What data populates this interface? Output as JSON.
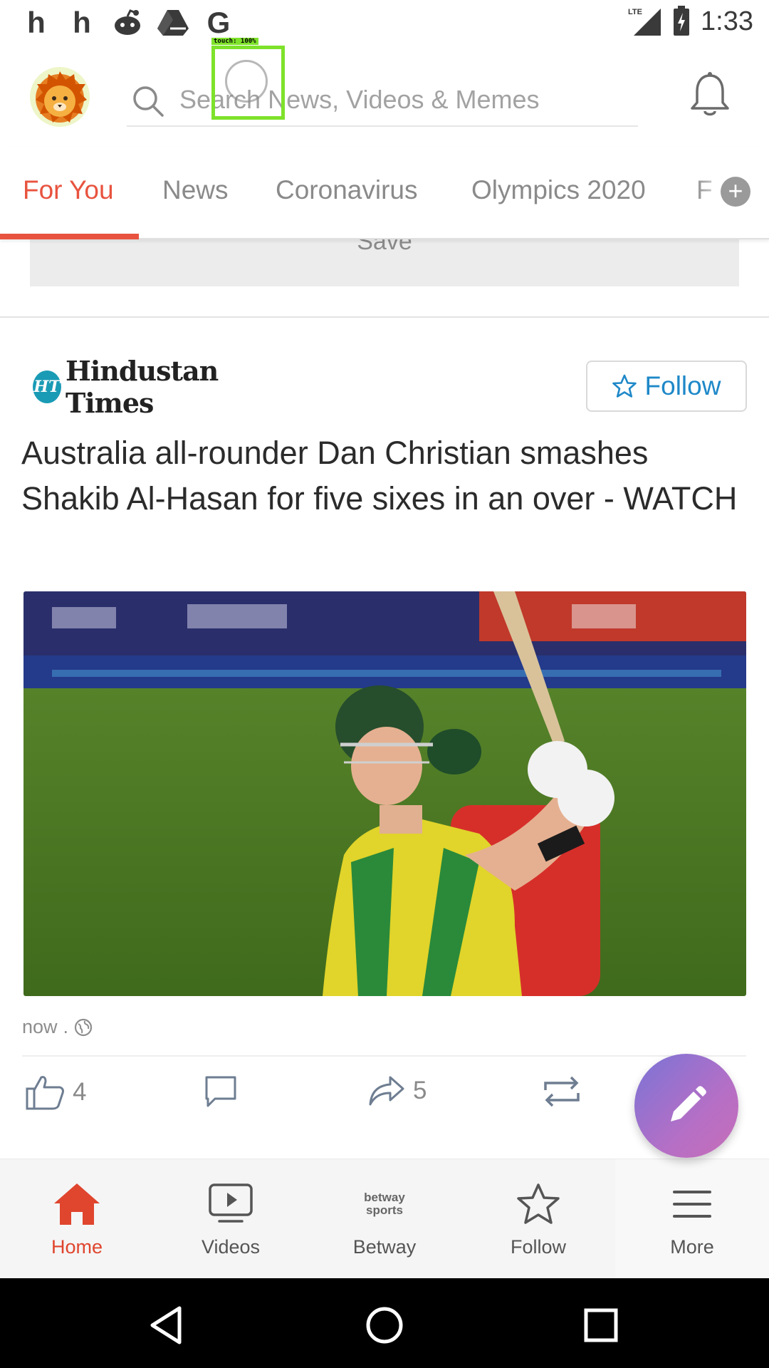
{
  "status_bar": {
    "notification_icons": [
      "h",
      "h",
      "reddit-icon",
      "drive-icon",
      "G"
    ],
    "network": "LTE",
    "time": "1:33"
  },
  "header": {
    "search_placeholder": "Search News, Videos & Memes"
  },
  "tabs": {
    "items": [
      "For You",
      "News",
      "Coronavirus",
      "Olympics 2020",
      "F"
    ],
    "active_index": 0,
    "accent_color": "#e8533f"
  },
  "previous_card": {
    "save_label": "Save"
  },
  "article": {
    "publisher_badge": "HT",
    "publisher_name": "Hindustan Times",
    "follow_label": "Follow",
    "headline": "Australia all-rounder Dan Christian smashes Shakib Al-Hasan for five sixes in an over - WATCH",
    "time": "now",
    "time_separator": ".",
    "likes": "4",
    "shares": "5"
  },
  "bottom_nav": {
    "items": [
      {
        "label": "Home",
        "icon": "home-icon"
      },
      {
        "label": "Videos",
        "icon": "videos-icon"
      },
      {
        "label": "Betway",
        "icon": "betway-sports-icon"
      },
      {
        "label": "Follow",
        "icon": "star-icon"
      },
      {
        "label": "More",
        "icon": "menu-icon"
      }
    ],
    "active_index": 0,
    "betway_logo_text_top": "betway",
    "betway_logo_text_bottom": "sports"
  },
  "overlay": {
    "touch_label": "touch: 100%"
  },
  "colors": {
    "brand_red": "#e8533f",
    "follow_blue": "#1e88c8",
    "fab_gradient_start": "#7a74d6",
    "fab_gradient_end": "#c86eb8"
  }
}
